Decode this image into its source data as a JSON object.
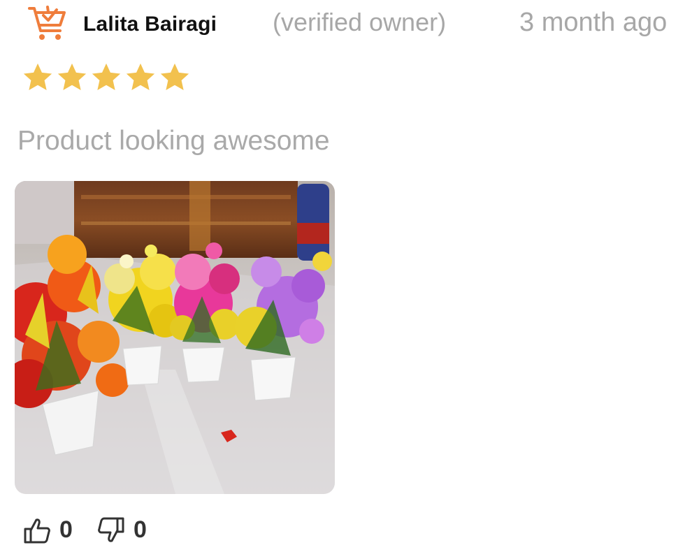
{
  "review": {
    "reviewer_name": "Lalita Bairagi",
    "verified_label": "(verified owner)",
    "time_ago": "3 month ago",
    "rating": 5,
    "rating_max": 5,
    "comment": "Product looking awesome",
    "likes": "0",
    "dislikes": "0"
  },
  "icons": {
    "reviewer": "cart-check-icon",
    "like": "thumbs-up-icon",
    "dislike": "thumbs-down-icon",
    "star": "star-icon"
  },
  "colors": {
    "accent_orange": "#ef7d3c",
    "star_gold": "#f2c14e",
    "muted_text": "#a7a7a7",
    "name_text": "#111111"
  }
}
